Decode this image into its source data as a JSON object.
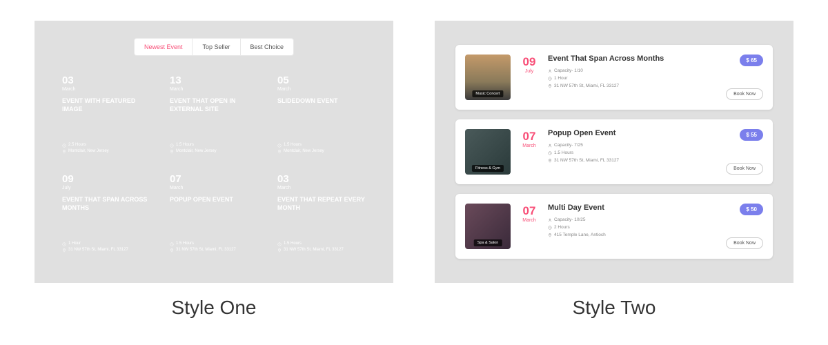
{
  "style_one_label": "Style One",
  "style_two_label": "Style Two",
  "tabs": [
    "Newest Event",
    "Top Seller",
    "Best Choice"
  ],
  "cards": [
    {
      "day": "03",
      "month": "March",
      "title": "EVENT WITH FEATURED IMAGE",
      "duration": "2.5 Hours",
      "location": "Montclair, New Jersey"
    },
    {
      "day": "13",
      "month": "March",
      "title": "EVENT THAT OPEN IN EXTERNAL SITE",
      "duration": "1.5 Hours",
      "location": "Montclair, New Jersey"
    },
    {
      "day": "05",
      "month": "March",
      "title": "SLIDEDOWN EVENT",
      "duration": "1.5 Hours",
      "location": "Montclair, New Jersey"
    },
    {
      "day": "09",
      "month": "July",
      "title": "EVENT THAT SPAN ACROSS MONTHS",
      "duration": "1 Hour",
      "location": "31 NW 57th St, Miami, FL 33127"
    },
    {
      "day": "07",
      "month": "March",
      "title": "POPUP OPEN EVENT",
      "duration": "1.5 Hours",
      "location": "31 NW 57th St, Miami, FL 33127"
    },
    {
      "day": "03",
      "month": "March",
      "title": "EVENT THAT REPEAT EVERY MONTH",
      "duration": "1.5 Hours",
      "location": "31 NW 57th St, Miami, FL 33127"
    }
  ],
  "rows": [
    {
      "day": "09",
      "month": "July",
      "category": "Music Concert",
      "title": "Event That Span Across Months",
      "capacity": "Capacity- 1/10",
      "duration": "1 Hour",
      "location": "31 NW 57th St, Miami, FL 33127",
      "price": "$ 65",
      "book": "Book Now"
    },
    {
      "day": "07",
      "month": "March",
      "category": "Fitness & Gym",
      "title": "Popup Open Event",
      "capacity": "Capacity- 7/25",
      "duration": "1.5 Hours",
      "location": "31 NW 57th St, Miami, FL 33127",
      "price": "$ 55",
      "book": "Book Now"
    },
    {
      "day": "07",
      "month": "March",
      "category": "Spa & Salon",
      "title": "Multi Day Event",
      "capacity": "Capacity- 10/25",
      "duration": "2 Hours",
      "location": "415 Temple Lane, Antioch",
      "price": "$ 50",
      "book": "Book Now"
    }
  ]
}
